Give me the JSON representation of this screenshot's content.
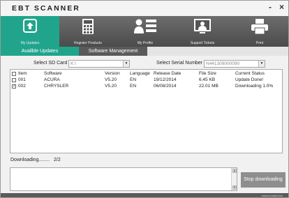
{
  "app": {
    "title": "EBT SCANNER",
    "minimize": "-",
    "close": "×"
  },
  "nav": [
    {
      "label": "My Updates",
      "icon": "upload-box-icon",
      "active": true
    },
    {
      "label": "Register Products",
      "icon": "calculator-icon",
      "active": false
    },
    {
      "label": "My Profile",
      "icon": "profile-card-icon",
      "active": false
    },
    {
      "label": "Support Tickets",
      "icon": "support-monitor-icon",
      "active": false
    },
    {
      "label": "Print",
      "icon": "printer-icon",
      "active": false
    }
  ],
  "tabs": {
    "active": "Availble Updates",
    "other": "Software Management"
  },
  "sd_card": {
    "label": "Select SD Card",
    "value": "K:\\"
  },
  "serial": {
    "label": "Select Serial Number",
    "value": "N441309000090"
  },
  "table": {
    "headers": {
      "item": "Item",
      "software": "Software",
      "version": "Version",
      "language": "Language",
      "release": "Release Date",
      "size": "File Size",
      "status": "Current Status"
    },
    "rows": [
      {
        "checked": false,
        "item": "001",
        "software": "ACURA",
        "version": "V5.20",
        "language": "EN",
        "release": "19/12/2014",
        "size": "6.45 KB",
        "status": "Update Done!"
      },
      {
        "checked": true,
        "item": "002",
        "software": "CHRYSLER",
        "version": "V5.20",
        "language": "EN",
        "release": "06/08/2014",
        "size": "22.01 MB",
        "status": "Downloading 1.0%"
      }
    ]
  },
  "download": {
    "label": "Downloading........",
    "count": "2/2"
  },
  "stop_button": "Stop downloading",
  "footer": {
    "url": "www.ecobat.tech"
  },
  "colors": {
    "accent": "#20a58c",
    "nav_bg": "#555555",
    "button": "#8e8e8e"
  }
}
